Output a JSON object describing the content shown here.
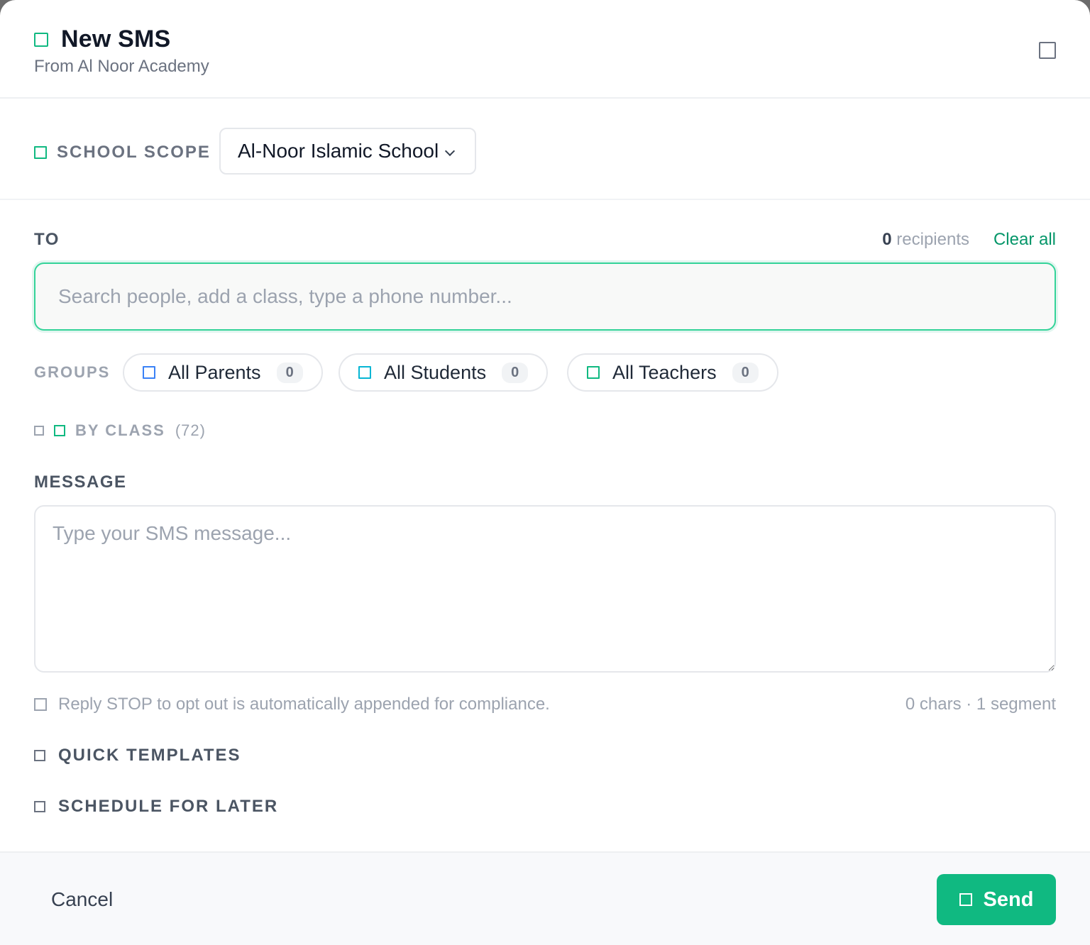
{
  "header": {
    "title": "New SMS",
    "subtitle": "From Al Noor Academy",
    "icon": "message-icon",
    "close_icon": "close-icon"
  },
  "scope": {
    "label": "SCHOOL SCOPE",
    "icon": "school-icon",
    "selected": "Al-Noor Islamic School"
  },
  "to": {
    "label": "TO",
    "recipient_count": "0",
    "recipient_suffix": " recipients",
    "clear_all": "Clear all",
    "search_placeholder": "Search people, add a class, type a phone number..."
  },
  "groups": {
    "label": "GROUPS",
    "items": [
      {
        "label": "All Parents",
        "count": "0",
        "color": "#3b82f6",
        "icon": "parents-icon"
      },
      {
        "label": "All Students",
        "count": "0",
        "color": "#06b6d4",
        "icon": "students-icon"
      },
      {
        "label": "All Teachers",
        "count": "0",
        "color": "#10b981",
        "icon": "teachers-icon"
      }
    ]
  },
  "by_class": {
    "label": "BY CLASS",
    "count": "(72)"
  },
  "message": {
    "label": "MESSAGE",
    "placeholder": "Type your SMS message...",
    "compliance_note": "Reply STOP to opt out is automatically appended for compliance.",
    "counter": "0 chars · 1 segment"
  },
  "sections": {
    "quick_templates": "QUICK TEMPLATES",
    "schedule": "SCHEDULE FOR LATER"
  },
  "footer": {
    "cancel": "Cancel",
    "send": "Send"
  },
  "colors": {
    "accent": "#10b981",
    "accent_text": "#059669"
  }
}
